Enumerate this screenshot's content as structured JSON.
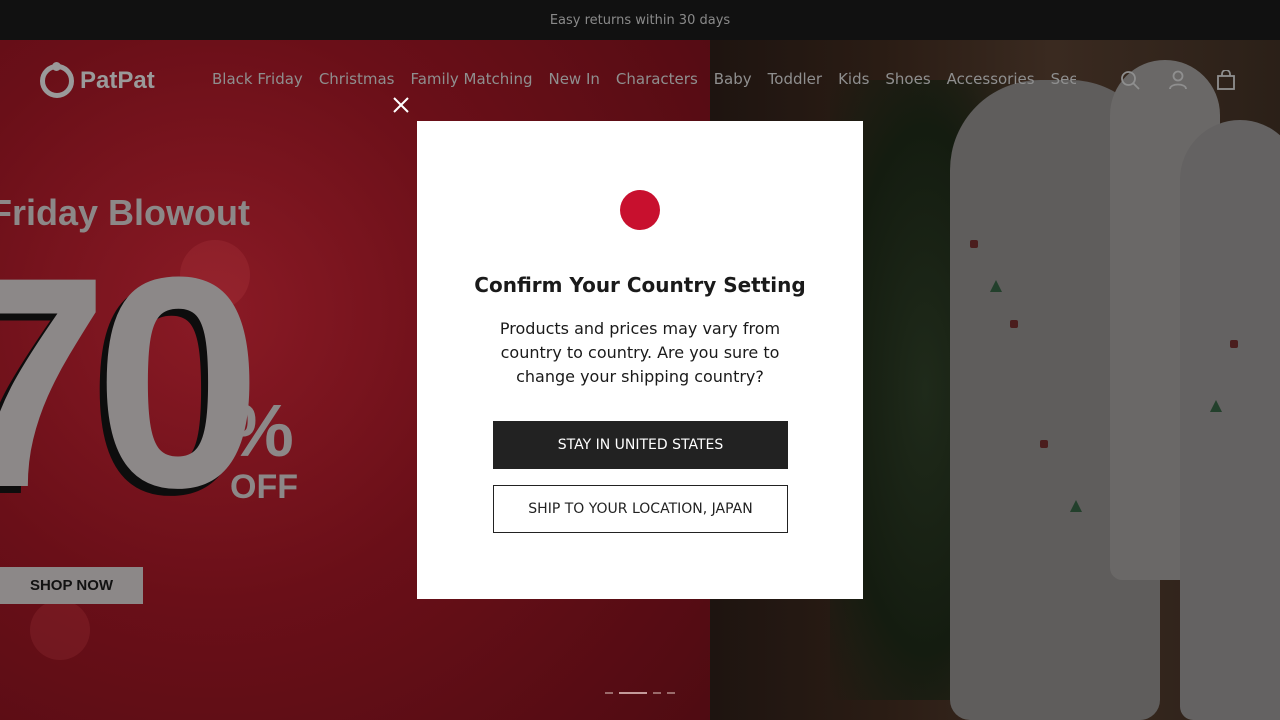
{
  "announcement": {
    "text": "Easy returns within 30 days"
  },
  "header": {
    "logo_text": "PatPat",
    "menu": [
      "Black Friday",
      "Christmas",
      "Family Matching",
      "New In",
      "Characters",
      "Baby",
      "Toddler",
      "Kids",
      "Shoes",
      "Accessories",
      "Seen on T"
    ],
    "icons": [
      "search-icon",
      "account-icon",
      "cart-icon"
    ]
  },
  "hero": {
    "headline": "Friday Blowout",
    "discount_number": "70",
    "discount_percent": "%",
    "discount_off": "OFF",
    "cta_label": "SHOP NOW",
    "carousel_slides": 4,
    "carousel_active": 2
  },
  "modal": {
    "title": "Confirm Your Country Setting",
    "body": "Products and prices may vary from country to country. Are you sure to change your shipping country?",
    "primary_button": "STAY IN UNITED STATES",
    "secondary_button": "SHIP TO YOUR LOCATION, JAPAN",
    "flag_icon": "japan-flag-icon",
    "close_icon": "close-icon"
  },
  "colors": {
    "flag_red": "#c8102e",
    "primary_button_bg": "#222222",
    "hero_red": "#6a0f18"
  }
}
